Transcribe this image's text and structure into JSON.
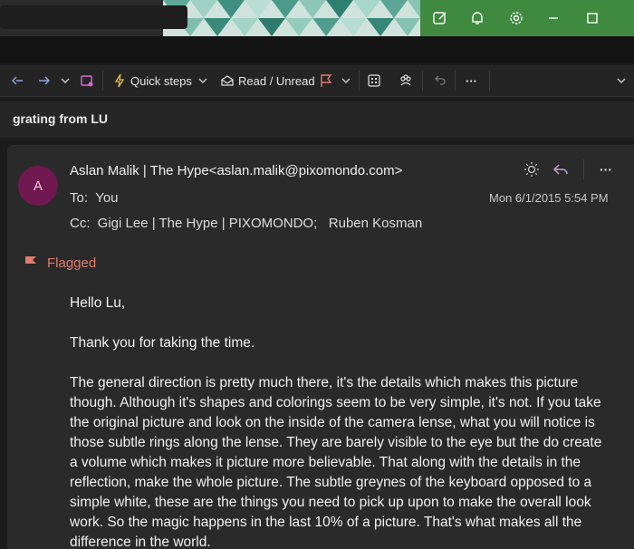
{
  "window": {
    "icons": [
      "compose-icon",
      "bell-icon",
      "gear-icon",
      "minimize-icon",
      "maximize-icon"
    ]
  },
  "toolbar": {
    "quick_steps_label": "Quick steps",
    "read_unread_label": "Read / Unread",
    "more_label": "···"
  },
  "message": {
    "subject": "grating from LU",
    "avatar_initial": "A",
    "from": "Aslan Malik | The Hype<aslan.malik@pixomondo.com>",
    "to_label": "To:",
    "to": "You",
    "cc_label": "Cc:",
    "cc": "Gigi Lee | The Hype | PIXOMONDO;   Ruben Kosman",
    "date": "Mon 6/1/2015 5:54 PM",
    "flag_label": "Flagged",
    "more_label": "···",
    "body": [
      "Hello Lu,",
      "Thank you for taking the time.",
      "The general direction is pretty much there, it's the details which makes this picture though. Although it's shapes and colorings seem to be very simple, it's not. If you take the original picture and look on the inside of the camera lense, what you will notice is those subtle rings along the lense. They are barely visible to the eye but the do create a volume which makes it picture more believable. That along with the details in the reflection, make the whole picture. The subtle greynes of the keyboard opposed to a simple white, these are the things you need to pick up upon to make the overall look work. So the magic happens in the last 10% of a picture. That's what makes all the difference in the world."
    ]
  },
  "colors": {
    "avatar": "#701850",
    "flag": "#e07a6b",
    "titlebar_accent": "#3f8a3f"
  }
}
